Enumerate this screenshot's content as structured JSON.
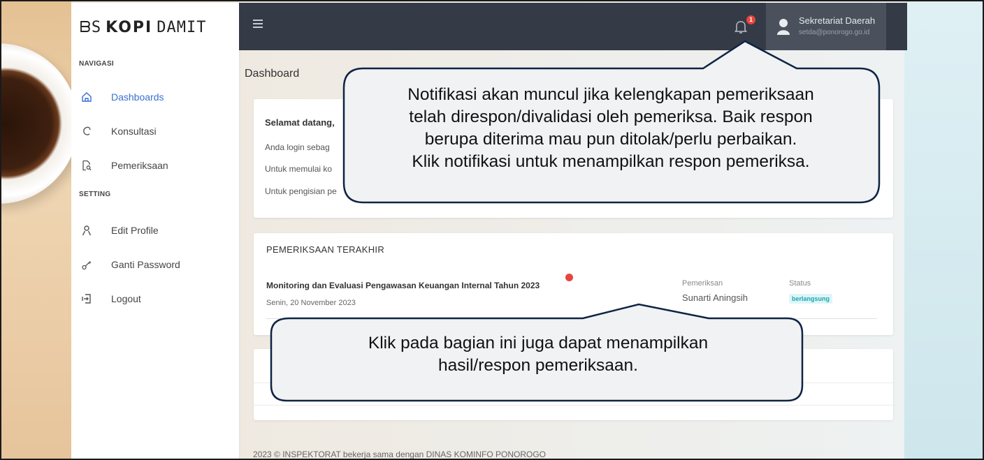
{
  "sidebar": {
    "logo": {
      "prefix": "ᗷS",
      "main": "KOPI",
      "suffix": "DAMIT"
    },
    "sections": {
      "nav": "NAVIGASI",
      "setting": "SETTING"
    },
    "items": [
      {
        "label": "Dashboards",
        "icon": "home-icon",
        "active": true
      },
      {
        "label": "Konsultasi",
        "icon": "consult-icon"
      },
      {
        "label": "Pemeriksaan",
        "icon": "document-search-icon"
      },
      {
        "label": "Edit Profile",
        "icon": "user-icon"
      },
      {
        "label": "Ganti Password",
        "icon": "key-icon"
      },
      {
        "label": "Logout",
        "icon": "logout-icon"
      }
    ]
  },
  "topbar": {
    "notification_count": "1",
    "user": {
      "name": "Sekretariat Daerah",
      "email": "setda@ponorogo.go.id"
    }
  },
  "main": {
    "page_title": "Dashboard",
    "welcome": {
      "title": "Selamat datang,",
      "lines": [
        "Anda login sebag",
        "Untuk memulai ko",
        "Untuk pengisian pe"
      ]
    },
    "latest": {
      "header": "PEMERIKSAAN TERAKHIR",
      "row": {
        "title": "Monitoring dan Evaluasi Pengawasan Keuangan Internal Tahun 2023",
        "date": "Senin, 20 November 2023",
        "examiner_label": "Pemeriksan",
        "examiner": "Sunarti Aningsih",
        "status_label": "Status",
        "status": "berlangsung"
      }
    },
    "footer": "2023 © INSPEKTORAT bekerja sama dengan DINAS KOMINFO PONOROGO"
  },
  "callouts": {
    "notification": [
      "Notifikasi akan muncul jika kelengkapan pemeriksaan",
      "telah direspon/divalidasi oleh pemeriksa. Baik respon",
      "berupa diterima mau pun ditolak/perlu perbaikan.",
      "Klik notifikasi untuk menampilkan respon pemeriksa."
    ],
    "row": [
      "Klik pada bagian ini juga dapat menampilkan",
      "hasil/respon pemeriksaan."
    ]
  },
  "colors": {
    "topbar": "#343a46",
    "accent": "#3b6fd1",
    "badge": "#e8453c",
    "status": "#1aa6b3"
  }
}
